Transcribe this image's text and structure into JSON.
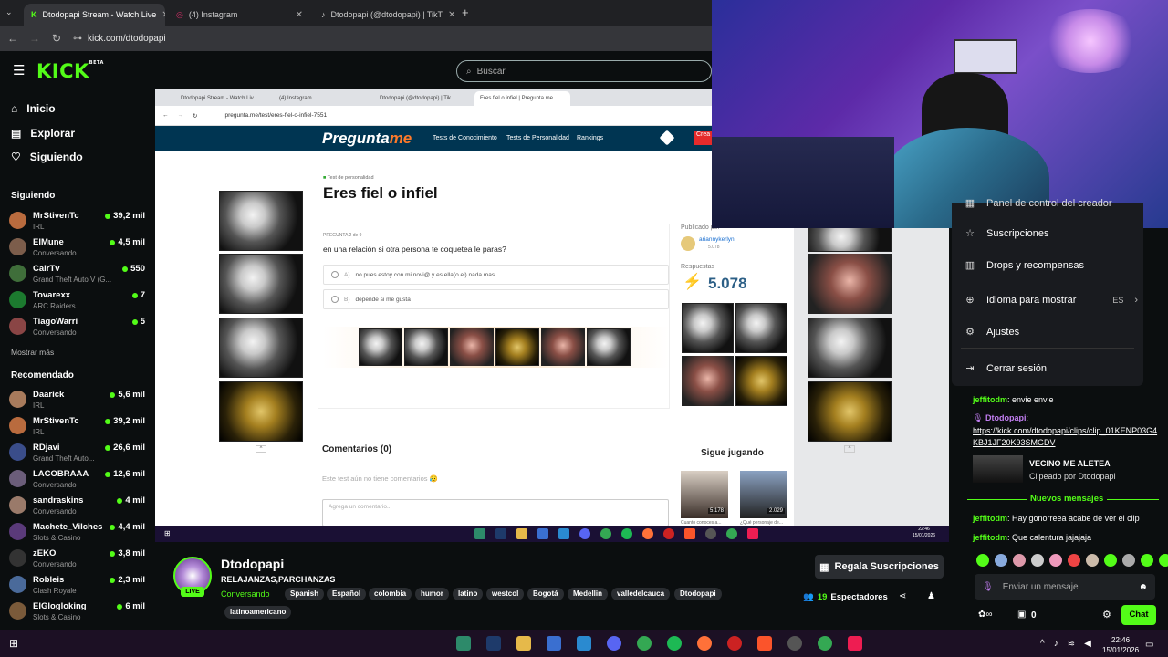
{
  "browser": {
    "tabs": [
      {
        "label": "Dtodopapi Stream - Watch Live",
        "active": true
      },
      {
        "label": "(4) Instagram",
        "active": false
      },
      {
        "label": "Dtodopapi (@dtodopapi) | TikT",
        "active": false
      }
    ],
    "new_tab": "+",
    "url": "kick.com/dtodopapi"
  },
  "kick": {
    "logo": "KICK",
    "beta": "BETA",
    "search_placeholder": "Buscar"
  },
  "sidebar": {
    "nav": [
      {
        "label": "Inicio",
        "icon": "home-icon"
      },
      {
        "label": "Explorar",
        "icon": "compass-icon"
      },
      {
        "label": "Siguiendo",
        "icon": "heart-icon"
      }
    ],
    "following_title": "Siguiendo",
    "following": [
      {
        "name": "MrStivenTc",
        "category": "IRL",
        "viewers": "39,2 mil",
        "color": "#b96b3e"
      },
      {
        "name": "ElMune",
        "category": "Conversando",
        "viewers": "4,5 mil",
        "color": "#7c5d4b"
      },
      {
        "name": "CairTv",
        "category": "Grand Theft Auto V (G...",
        "viewers": "550",
        "color": "#3f6e3a"
      },
      {
        "name": "Tovarexx",
        "category": "ARC Raiders",
        "viewers": "7",
        "color": "#1c7a2f"
      },
      {
        "name": "TiagoWarri",
        "category": "Conversando",
        "viewers": "5",
        "color": "#8a4545"
      }
    ],
    "show_more": "Mostrar más",
    "recommended_title": "Recomendado",
    "recommended": [
      {
        "name": "Daarick",
        "category": "IRL",
        "viewers": "5,6 mil",
        "color": "#a87b5c"
      },
      {
        "name": "MrStivenTc",
        "category": "IRL",
        "viewers": "39,2 mil",
        "color": "#b96b3e"
      },
      {
        "name": "RDjavi",
        "category": "Grand Theft Auto...",
        "viewers": "26,6 mil",
        "color": "#3a4d8a"
      },
      {
        "name": "LACOBRAAA",
        "category": "Conversando",
        "viewers": "12,6 mil",
        "color": "#6b5d7a"
      },
      {
        "name": "sandraskins",
        "category": "Conversando",
        "viewers": "4 mil",
        "color": "#9a7a6a"
      },
      {
        "name": "Machete_Vilches",
        "category": "Slots & Casino",
        "viewers": "4,4 mil",
        "color": "#5a3a7a"
      },
      {
        "name": "zEKO",
        "category": "Conversando",
        "viewers": "3,8 mil",
        "color": "#333333"
      },
      {
        "name": "Robleis",
        "category": "Clash Royale",
        "viewers": "2,3 mil",
        "color": "#4a6a9a"
      },
      {
        "name": "ElGlogloking",
        "category": "Slots & Casino",
        "viewers": "6 mil",
        "color": "#7a5a3a"
      }
    ]
  },
  "stream": {
    "inner_tabs": [
      {
        "label": "Dtodopapi Stream - Watch Liv",
        "active": false
      },
      {
        "label": "(4) Instagram",
        "active": false
      },
      {
        "label": "Dtodopapi (@dtodopapi) | Tik",
        "active": false
      },
      {
        "label": "Eres fiel o infiel | Pregunta.me",
        "active": true
      }
    ],
    "inner_url": "pregunta.me/test/eres-fiel-o-infiel-7551",
    "site": {
      "logo_a": "Pregunta",
      "logo_b": "me",
      "nav": [
        "Tests de Conocimiento",
        "Tests de Personalidad",
        "Rankings"
      ],
      "create": "Crea"
    },
    "quiz": {
      "breadcrumb": "Test de personalidad",
      "title": "Eres fiel o infiel",
      "question_number": "PREGUNTA 2 de 9",
      "question": "en una relación si otra persona te coquetea le paras?",
      "options": [
        {
          "letter": "A)",
          "text": "no pues estoy con mi novi@ y es ella(o el) nada mas"
        },
        {
          "letter": "B)",
          "text": "depende si me gusta"
        }
      ],
      "published_label": "Publicado por",
      "author": "ariannykerlyn",
      "author_count": "5.078",
      "responses_label": "Respuestas",
      "responses": "5.078",
      "comments_title": "Comentarios (0)",
      "no_comments": "Este test aún no tiene comentarios 😥",
      "comment_placeholder": "Agrega un comentario...",
      "keep_playing": "Sigue jugando",
      "related": [
        {
          "count": "5.178",
          "caption": "Cuanto conoces a..."
        },
        {
          "count": "2.029",
          "caption": "¿Qué personaje de..."
        }
      ]
    },
    "clock_time": "22:46",
    "clock_date": "15/01/2026"
  },
  "menu": {
    "items": [
      {
        "label": "Panel de control del creador",
        "icon": "dashboard-icon"
      },
      {
        "label": "Suscripciones",
        "icon": "star-icon"
      },
      {
        "label": "Drops y recompensas",
        "icon": "gift-icon"
      },
      {
        "label": "Idioma para mostrar",
        "icon": "globe-icon",
        "value": "ES"
      },
      {
        "label": "Ajustes",
        "icon": "gear-icon"
      },
      {
        "label": "Cerrar sesión",
        "icon": "logout-icon"
      }
    ]
  },
  "chat": {
    "messages": [
      {
        "user": "jeffitodm",
        "text": ": envie envie"
      },
      {
        "user": "Dtodopapi",
        "text": ":"
      },
      {
        "user": "",
        "text": "https://kick.com/dtodopapi/clips/clip_01KENP03G4KBJ1JF20K93SMGDV"
      }
    ],
    "clip": {
      "title": "VECINO ME ALETEA",
      "by": "Clipeado por Dtodopapi"
    },
    "new_messages": "Nuevos mensajes",
    "after": [
      {
        "user": "jeffitodm",
        "text": ": Hay gonorreea acabe de ver el clip"
      },
      {
        "user": "jeffitodm",
        "text": ": Que calentura jajajaja"
      }
    ],
    "input_placeholder": "Enviar un mensaje",
    "points": "0",
    "send_label": "Chat"
  },
  "channel": {
    "name": "Dtodopapi",
    "title": "RELAJANZAS,PARCHANZAS",
    "category": "Conversando",
    "live": "LIVE",
    "tags": [
      "Spanish",
      "Español",
      "colombia",
      "humor",
      "latino",
      "westcol",
      "Bogotá",
      "Medellin",
      "valledelcauca",
      "Dtodopapi",
      "latinoamericano"
    ],
    "viewers_count": "19",
    "viewers_label": "Espectadores",
    "gift_subs": "Regala Suscripciones"
  },
  "taskbar": {
    "time": "22:46",
    "date": "15/01/2026"
  }
}
